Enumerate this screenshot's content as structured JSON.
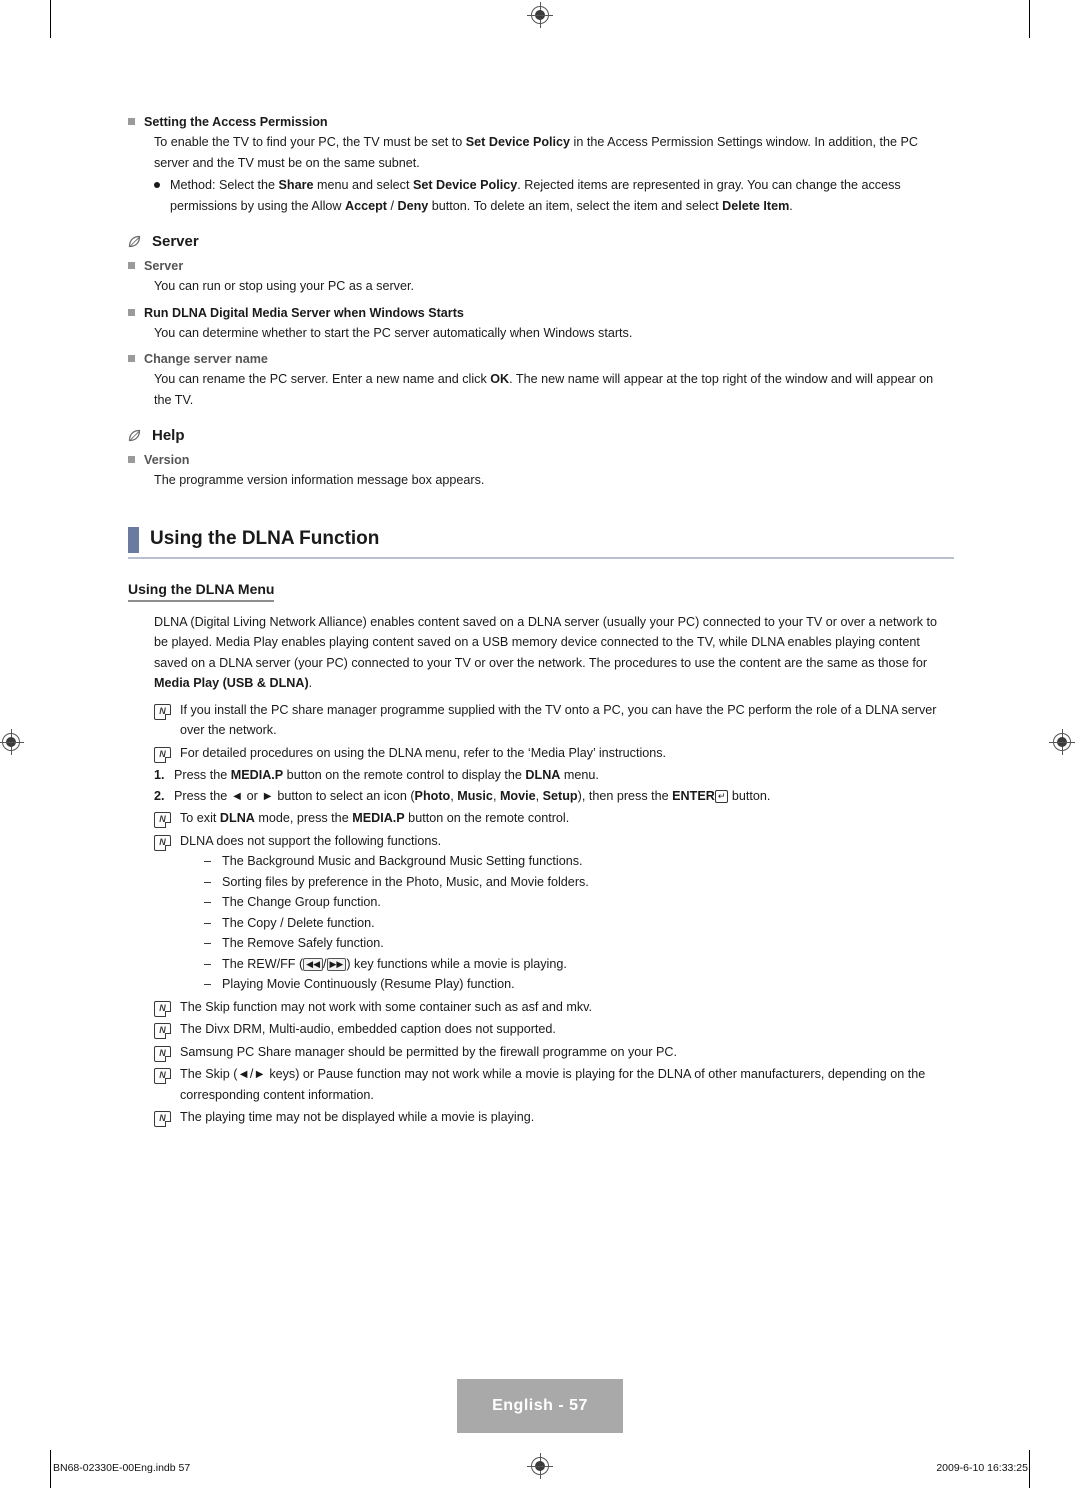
{
  "page": {
    "number_badge": "English - 57",
    "footer_left": "BN68-02330E-00Eng.indb   57",
    "footer_right": "2009-6-10   16:33:25"
  },
  "access_permission": {
    "heading": "Setting the Access Permission",
    "paragraph_1": "To enable the TV to find your PC, the TV must be set to ",
    "paragraph_1_b1": "Set Device Policy",
    "paragraph_1_cont": " in the Access Permission Settings window. In addition, the PC server and the TV must be on the same subnet.",
    "method_1": "Method: Select the ",
    "method_b1": "Share",
    "method_2": " menu and select ",
    "method_b2": "Set Device Policy",
    "method_3": ". Rejected items are represented in gray. You can change the access permissions by using the Allow ",
    "method_b3": "Accept",
    "method_4": " / ",
    "method_b4": "Deny",
    "method_5": " button. To delete an item, select the item and select ",
    "method_b5": "Delete Item",
    "method_6": "."
  },
  "server_section": {
    "title": "Server",
    "sub_1_heading": "Server",
    "sub_1_text": "You can run or stop using your PC as a server.",
    "sub_2_heading": "Run DLNA Digital Media Server when Windows Starts",
    "sub_2_text": "You can determine whether to start the PC server automatically when Windows starts.",
    "sub_3_heading": "Change server name",
    "sub_3_text_a": "You can rename the PC server. Enter a new name and click ",
    "sub_3_text_b": "OK",
    "sub_3_text_c": ". The new name will appear at the top right of the window and will appear on the TV."
  },
  "help_section": {
    "title": "Help",
    "sub_1_heading": "Version",
    "sub_1_text": "The programme version information message box appears."
  },
  "chapter": {
    "title": "Using the DLNA Function"
  },
  "dlna_menu": {
    "heading": "Using the DLNA Menu",
    "intro_a": "DLNA (Digital Living Network Alliance) enables content saved on a DLNA server (usually your PC) connected to your TV or over a network to be played. Media Play enables playing content saved on a USB memory device connected to the TV, while DLNA enables playing content saved on a DLNA server (your PC) connected to your TV or over the network. The procedures to use the content are the same as those for ",
    "intro_b": "Media Play (USB & DLNA)",
    "intro_c": ".",
    "notes_top": [
      "If you install the PC share manager programme supplied with the TV onto a PC, you can have the PC perform the role of a DLNA server over the network.",
      "For detailed procedures on using the DLNA menu, refer to the ‘Media Play’ instructions."
    ],
    "steps": [
      {
        "num": "1.",
        "a": "Press the ",
        "b1": "MEDIA.P",
        "c": " button on the remote control to display the ",
        "b2": "DLNA",
        "d": " menu."
      },
      {
        "num": "2.",
        "a": "Press the ◄ or ► button to select an icon (",
        "b1": "Photo",
        "c": ", ",
        "b2": "Music",
        "d": ", ",
        "b3": "Movie",
        "e": ", ",
        "b4": "Setup",
        "f": "), then press the ",
        "b5": "ENTER",
        "g": " button."
      }
    ],
    "notes_mid": [
      {
        "a": "To exit ",
        "b1": "DLNA",
        "c": " mode, press the ",
        "b2": "MEDIA.P",
        "d": " button on the remote control."
      },
      {
        "a": "DLNA does not support the following functions."
      }
    ],
    "unsupported": [
      "The Background Music and Background Music Setting functions.",
      "Sorting files by preference in the Photo, Music, and Movie folders.",
      "The Change Group function.",
      "The Copy / Delete function.",
      "The Remove Safely function.",
      "The REW/FF (◄◄/►►) key functions while a movie is playing.",
      "Playing Movie Continuously (Resume Play) function."
    ],
    "notes_bottom": [
      "The Skip function may not work with some container such as asf and mkv.",
      "The Divx DRM, Multi-audio, embedded caption does not supported.",
      "Samsung PC Share manager should be permitted by the firewall programme on your PC.",
      "The Skip (◄/►  keys) or Pause function may not work while a movie is playing for the DLNA of other manufacturers, depending on the corresponding content information.",
      "The playing time may not be displayed while a movie is playing."
    ],
    "note_icon_label": "N"
  },
  "colors": {
    "chapter_bar": "#6a7ba2",
    "chapter_rule": "#b9bfce",
    "badge_bg": "#a9a9a9",
    "bullet_square": "#9a9a9a"
  }
}
